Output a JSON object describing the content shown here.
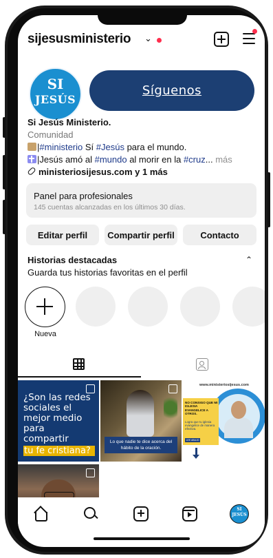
{
  "header": {
    "username": "sijesusministerio",
    "chevron": "⌄"
  },
  "profile": {
    "avatar_text_top": "SI",
    "avatar_text_bottom": "JESÚS",
    "follow_label": "Síguenos",
    "name": "Si Jesús Ministerio.",
    "category": "Comunidad",
    "bio_line1_a": "|",
    "bio_line1_tag1": "#ministerio",
    "bio_line1_b": " Sí ",
    "bio_line1_tag2": "#Jesús",
    "bio_line1_c": " para el mundo.",
    "bio_line2_a": "|Jesús amó al ",
    "bio_line2_tag1": "#mundo",
    "bio_line2_b": " al morir en la ",
    "bio_line2_tag2": "#cruz",
    "bio_line2_c": "...",
    "bio_more": " más",
    "website": "ministeriosijesus.com y 1 más"
  },
  "panel": {
    "title": "Panel para profesionales",
    "subtitle": "145 cuentas alcanzadas en los últimos 30 días."
  },
  "actions": {
    "edit": "Editar perfil",
    "share": "Compartir perfil",
    "contact": "Contacto"
  },
  "highlights": {
    "title": "Historias destacadas",
    "subtitle": "Guarda tus historias favoritas en el perfil",
    "new_label": "Nueva",
    "caret": "⌃"
  },
  "posts": {
    "post1_text": "¿Son las redes sociales el mejor medio para compartir",
    "post1_highlight": "tu fe cristiana?",
    "post2_caption": "Lo que nadie te dice acerca del hábito de la oración.",
    "post3_url": "www.ministeriosijesus.com",
    "post3_title": "NO CONSIGO QUE MI IGLESIA EVANGELICE A OTROS.",
    "post3_sub": "Logra que tu iglesia evangelice de manera efectiva.",
    "post3_btn": "LEE ABAJO"
  },
  "bottom_nav": {
    "profile_text": "SI JESÚS"
  },
  "colors": {
    "accent": "#1c3f73",
    "notification": "#ff2e4d",
    "brand_blue": "#1a8fd0",
    "hashtag": "#1e3a8a"
  }
}
